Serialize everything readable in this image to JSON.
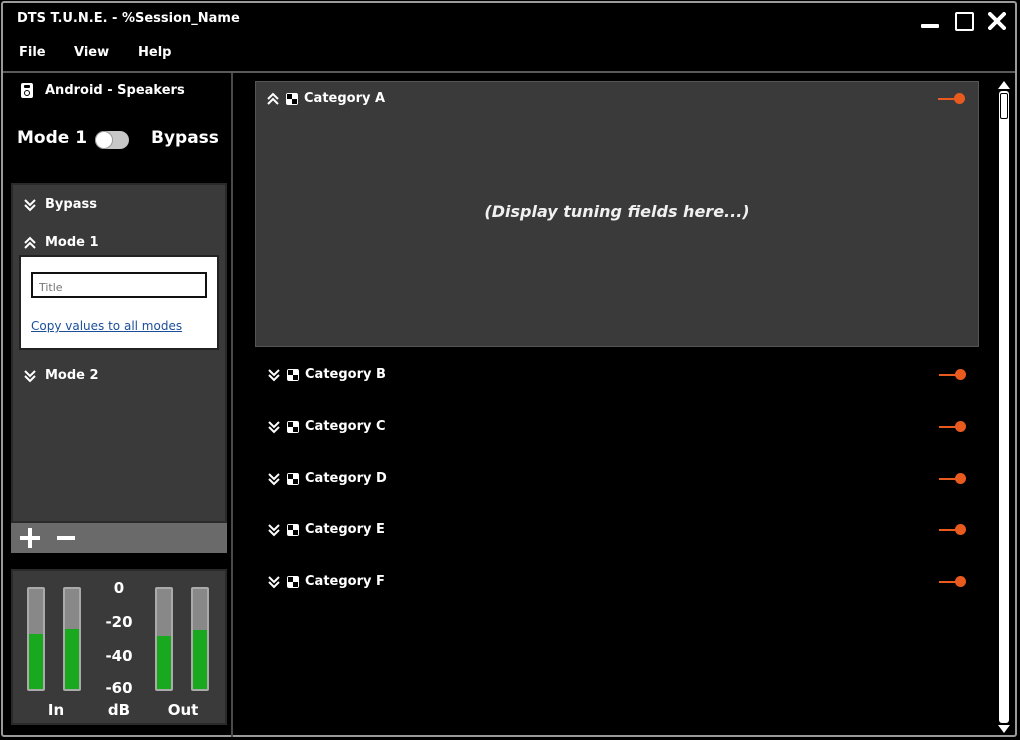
{
  "window": {
    "title": "DTS T.U.N.E. - %Session_Name"
  },
  "menu": {
    "file": "File",
    "view": "View",
    "help": "Help"
  },
  "sidebar": {
    "device": "Android - Speakers",
    "toggle_left": "Mode 1",
    "toggle_right": "Bypass",
    "modes": [
      {
        "label": "Bypass",
        "expanded": false
      },
      {
        "label": "Mode 1",
        "expanded": true
      },
      {
        "label": "Mode 2",
        "expanded": false
      }
    ],
    "mode_card": {
      "title_placeholder": "Title",
      "copy_link": "Copy values to all modes"
    }
  },
  "meters": {
    "scale": [
      "0",
      "-20",
      "-40",
      "-60"
    ],
    "in_label": "In",
    "db_label": "dB",
    "out_label": "Out",
    "fill_color": "#19a91e",
    "levels": [
      0.55,
      0.6,
      0.53,
      0.59
    ]
  },
  "categories": [
    {
      "label": "Category A",
      "expanded": true,
      "placeholder": "(Display tuning fields here...)"
    },
    {
      "label": "Category B",
      "expanded": false
    },
    {
      "label": "Category C",
      "expanded": false
    },
    {
      "label": "Category D",
      "expanded": false
    },
    {
      "label": "Category E",
      "expanded": false
    },
    {
      "label": "Category F",
      "expanded": false
    }
  ],
  "colors": {
    "accent": "#e85a1e",
    "panel": "#3a3a3a",
    "link": "#1a4e9a"
  }
}
